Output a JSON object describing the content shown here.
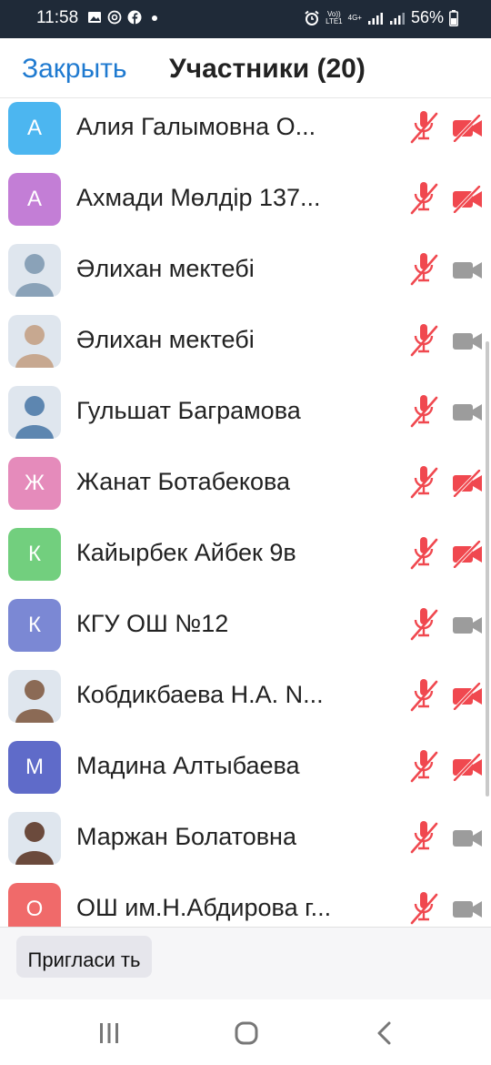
{
  "status_bar": {
    "time": "11:58",
    "left_icons": [
      "image-icon",
      "at-icon",
      "facebook-icon",
      "dot-icon"
    ],
    "volte": "Vo))",
    "lte": "LTE1",
    "net": "4G+",
    "battery": "56%"
  },
  "header": {
    "close_label": "Закрыть",
    "title": "Участники (20)"
  },
  "participants": [
    {
      "name": "Алия Галымовна О...",
      "initial": "А",
      "avatar_color": "#4cb6f0",
      "photo": false,
      "mic_muted": true,
      "video_off": true
    },
    {
      "name": "Ахмади Мөлдір 137...",
      "initial": "А",
      "avatar_color": "#c37ed6",
      "photo": false,
      "mic_muted": true,
      "video_off": true
    },
    {
      "name": "Әлихан мектебі",
      "initial": "",
      "avatar_color": "#8aa2b8",
      "photo": true,
      "mic_muted": true,
      "video_off": false
    },
    {
      "name": "Әлихан мектебі",
      "initial": "",
      "avatar_color": "#c7a890",
      "photo": true,
      "mic_muted": true,
      "video_off": false
    },
    {
      "name": "Гульшат Баграмова",
      "initial": "",
      "avatar_color": "#5d86b0",
      "photo": true,
      "mic_muted": true,
      "video_off": false
    },
    {
      "name": "Жанат Ботабекова",
      "initial": "Ж",
      "avatar_color": "#e58bbb",
      "photo": false,
      "mic_muted": true,
      "video_off": true
    },
    {
      "name": "Кайырбек Айбек 9в",
      "initial": "К",
      "avatar_color": "#72cf7e",
      "photo": false,
      "mic_muted": true,
      "video_off": true
    },
    {
      "name": "КГУ ОШ №12",
      "initial": "К",
      "avatar_color": "#7b88d4",
      "photo": false,
      "mic_muted": true,
      "video_off": false
    },
    {
      "name": "Кобдикбаева Н.А. N...",
      "initial": "",
      "avatar_color": "#8b6a55",
      "photo": true,
      "mic_muted": true,
      "video_off": true
    },
    {
      "name": "Мадина Алтыбаева",
      "initial": "М",
      "avatar_color": "#5f6bc9",
      "photo": false,
      "mic_muted": true,
      "video_off": true
    },
    {
      "name": "Маржан Болатовна",
      "initial": "",
      "avatar_color": "#6b4a3c",
      "photo": true,
      "mic_muted": true,
      "video_off": false
    },
    {
      "name": "ОШ им.Н.Абдирова г...",
      "initial": "О",
      "avatar_color": "#f06a6a",
      "photo": false,
      "mic_muted": true,
      "video_off": false
    }
  ],
  "bottom_bar": {
    "invite_label": "Пригласи ть"
  },
  "colors": {
    "accent": "#1f7ad0",
    "muted_red": "#f0484f",
    "icon_gray": "#9c9c9c",
    "status_bar_bg": "#1f2a38"
  }
}
